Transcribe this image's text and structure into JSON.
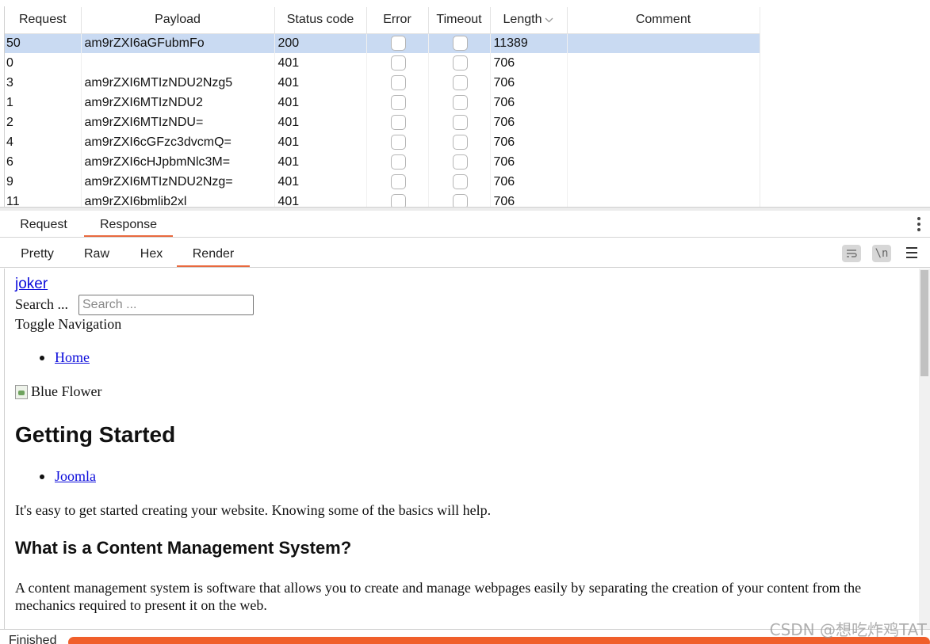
{
  "table": {
    "columns": [
      "Request",
      "Payload",
      "Status code",
      "Error",
      "Timeout",
      "Length",
      "Comment"
    ],
    "sorted_column_icon": "chevron-down-icon",
    "rows": [
      {
        "request": "50",
        "payload": "am9rZXI6aGFubmFo",
        "status": "200",
        "length": "11389",
        "selected": true
      },
      {
        "request": "0",
        "payload": "",
        "status": "401",
        "length": "706"
      },
      {
        "request": "3",
        "payload": "am9rZXI6MTIzNDU2Nzg5",
        "status": "401",
        "length": "706"
      },
      {
        "request": "1",
        "payload": "am9rZXI6MTIzNDU2",
        "status": "401",
        "length": "706"
      },
      {
        "request": "2",
        "payload": "am9rZXI6MTIzNDU=",
        "status": "401",
        "length": "706"
      },
      {
        "request": "4",
        "payload": "am9rZXI6cGFzc3dvcmQ=",
        "status": "401",
        "length": "706"
      },
      {
        "request": "6",
        "payload": "am9rZXI6cHJpbmNlc3M=",
        "status": "401",
        "length": "706"
      },
      {
        "request": "9",
        "payload": "am9rZXI6MTIzNDU2Nzg=",
        "status": "401",
        "length": "706"
      },
      {
        "request": "11",
        "payload": "am9rZXI6bmlib2xl",
        "status": "401",
        "length": "706"
      }
    ]
  },
  "message_tabs": {
    "items": [
      "Request",
      "Response"
    ],
    "active": "Response"
  },
  "view_tabs": {
    "items": [
      "Pretty",
      "Raw",
      "Hex",
      "Render"
    ],
    "active": "Render"
  },
  "toolbar": {
    "wrap_icon": "word-wrap-icon",
    "newline_label": "\\n",
    "menu_icon": "hamburger-menu-icon"
  },
  "render": {
    "site_link": "joker",
    "search_label": "Search ...",
    "search_placeholder": "Search ...",
    "toggle_nav": "Toggle Navigation",
    "nav_item": "Home",
    "image_alt": "Blue Flower",
    "heading": "Getting Started",
    "list_item": "Joomla",
    "intro": "It's easy to get started creating your website. Knowing some of the basics will help.",
    "subheading": "What is a Content Management System?",
    "body": "A content management system is software that allows you to create and manage webpages easily by separating the creation of your content from the mechanics required to present it on the web."
  },
  "status": {
    "text": "Finished",
    "progress": 1.0,
    "progress_color": "#f05f2b"
  },
  "watermark": "CSDN @想吃炸鸡TAT",
  "colors": {
    "accent": "#e8693e",
    "selected_row": "#c9daf2",
    "link": "#0b0bdb"
  }
}
